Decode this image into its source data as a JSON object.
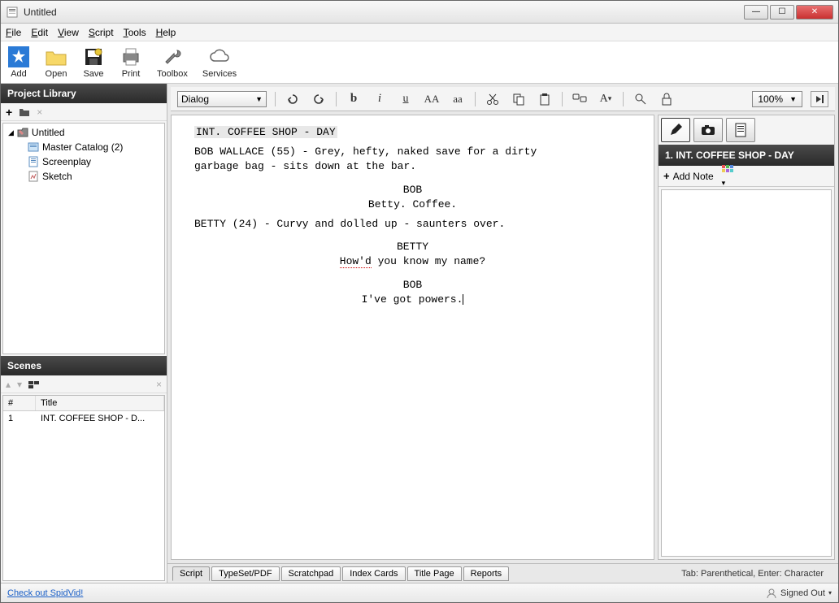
{
  "window": {
    "title": "Untitled"
  },
  "menu": {
    "file": "File",
    "edit": "Edit",
    "view": "View",
    "script": "Script",
    "tools": "Tools",
    "help": "Help"
  },
  "toolbar": {
    "add": "Add",
    "open": "Open",
    "save": "Save",
    "print": "Print",
    "toolbox": "Toolbox",
    "services": "Services"
  },
  "project_library": {
    "title": "Project Library",
    "root": "Untitled",
    "items": [
      {
        "label": "Master Catalog (2)"
      },
      {
        "label": "Screenplay"
      },
      {
        "label": "Sketch"
      }
    ]
  },
  "scenes": {
    "title": "Scenes",
    "col_num": "#",
    "col_title": "Title",
    "rows": [
      {
        "num": "1",
        "title": "INT. COFFEE SHOP - D..."
      }
    ]
  },
  "editor": {
    "element_type": "Dialog",
    "zoom": "100%",
    "scene_heading": "INT. COFFEE SHOP - DAY",
    "action1_a": "BOB WALLACE (55) - Grey, hefty, naked save for a dirty",
    "action1_b": "garbage bag - sits down at the bar.",
    "char1": "BOB",
    "dialog1": "Betty.  Coffee.",
    "action2": "BETTY (24) - Curvy and dolled up - saunters over.",
    "char2": "BETTY",
    "dialog2_a": "How'd",
    "dialog2_b": " you know my name?",
    "char3": "BOB",
    "dialog3": "I've got powers."
  },
  "right": {
    "scene_label": "1. INT. COFFEE SHOP - DAY",
    "add_note": "Add Note"
  },
  "bottom_tabs": {
    "script": "Script",
    "typeset": "TypeSet/PDF",
    "scratch": "Scratchpad",
    "index": "Index Cards",
    "titlepage": "Title Page",
    "reports": "Reports",
    "hint": "Tab: Parenthetical, Enter: Character"
  },
  "status": {
    "link": "Check out SpidVid!",
    "signed": "Signed Out"
  }
}
